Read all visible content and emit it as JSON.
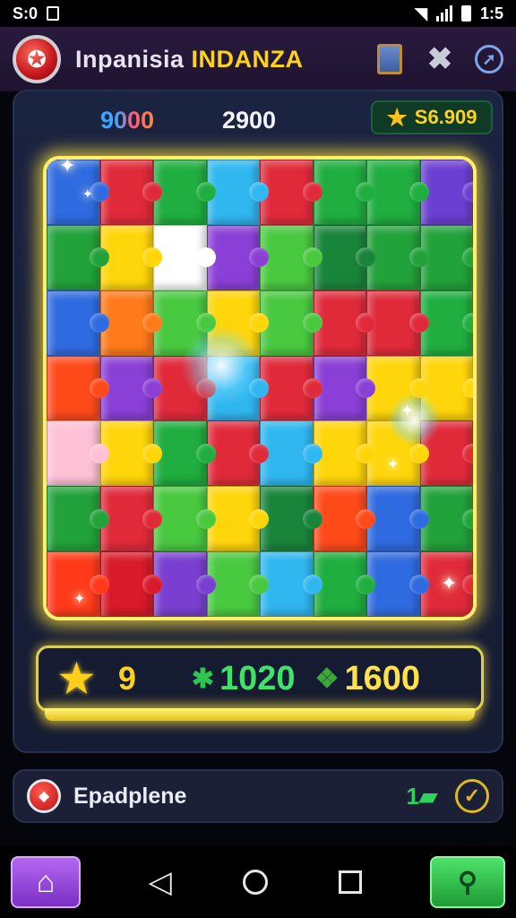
{
  "statusbar": {
    "time_left": "S:0",
    "time_right": "1:5"
  },
  "header": {
    "title_part1": "Inpanisia",
    "title_part2": "INDANZA"
  },
  "scores": {
    "score_a": "9000",
    "score_b": "2900",
    "coins": "S6.909"
  },
  "board": {
    "colors": [
      "#2f6be0",
      "#e02a3a",
      "#1fae3f",
      "#30b7f0",
      "#e02a3a",
      "#1fae3f",
      "#1fae3f",
      "#6b3fd1",
      "#22a23a",
      "#ffd60a",
      "#ffffff",
      "#8a3fd6",
      "#49c93f",
      "#18853a",
      "#22a23a",
      "#22a23a",
      "#2f6be0",
      "#ff7a1a",
      "#49c93f",
      "#ffd60a",
      "#49c93f",
      "#e02a3a",
      "#e02a3a",
      "#1fae3f",
      "#ff4a1a",
      "#8a3fd6",
      "#e02a3a",
      "#30b7f0",
      "#e02a3a",
      "#8a3fd6",
      "#ffd60a",
      "#ffd60a",
      "#ffc1d6",
      "#ffd60a",
      "#1fae3f",
      "#e02a3a",
      "#30b7f0",
      "#ffd60a",
      "#ffd60a",
      "#e02a3a",
      "#22a23a",
      "#e02a3a",
      "#49c93f",
      "#ffd60a",
      "#18853a",
      "#ff4a1a",
      "#2f6be0",
      "#22a23a",
      "#ff3a1a",
      "#d91a2a",
      "#7a3fd1",
      "#49c93f",
      "#30b7f0",
      "#1fae3f",
      "#2f6be0",
      "#e02a3a"
    ]
  },
  "stats": {
    "stars": "9",
    "green_count": "1020",
    "yellow_count": "1600"
  },
  "action": {
    "label": "Epadplene",
    "right_icon_text": "1"
  },
  "colors": {
    "accent_yellow": "#ffd21a",
    "accent_green": "#3fe26a",
    "panel": "#151c33"
  }
}
